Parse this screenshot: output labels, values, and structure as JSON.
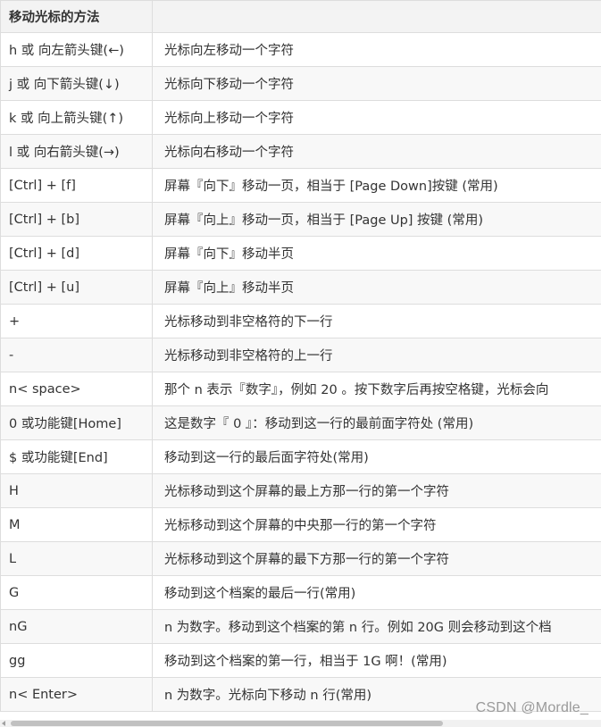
{
  "table": {
    "header": {
      "key": "移动光标的方法",
      "desc": ""
    },
    "rows": [
      {
        "key": "h 或 向左箭头键(←)",
        "desc": "光标向左移动一个字符"
      },
      {
        "key": "j 或 向下箭头键(↓)",
        "desc": "光标向下移动一个字符"
      },
      {
        "key": "k 或 向上箭头键(↑)",
        "desc": "光标向上移动一个字符"
      },
      {
        "key": "l 或 向右箭头键(→)",
        "desc": "光标向右移动一个字符"
      },
      {
        "key": "[Ctrl] + [f]",
        "desc": "屏幕『向下』移动一页，相当于 [Page Down]按键 (常用)"
      },
      {
        "key": "[Ctrl] + [b]",
        "desc": "屏幕『向上』移动一页，相当于 [Page Up] 按键 (常用)"
      },
      {
        "key": "[Ctrl] + [d]",
        "desc": "屏幕『向下』移动半页"
      },
      {
        "key": "[Ctrl] + [u]",
        "desc": "屏幕『向上』移动半页"
      },
      {
        "key": "+",
        "desc": "光标移动到非空格符的下一行"
      },
      {
        "key": "-",
        "desc": "光标移动到非空格符的上一行"
      },
      {
        "key": "n< space>",
        "desc": "那个 n 表示『数字』，例如 20 。按下数字后再按空格键，光标会向"
      },
      {
        "key": "0 或功能键[Home]",
        "desc": "这是数字『 0 』：移动到这一行的最前面字符处 (常用)"
      },
      {
        "key": "$ 或功能键[End]",
        "desc": "移动到这一行的最后面字符处(常用)"
      },
      {
        "key": "H",
        "desc": "光标移动到这个屏幕的最上方那一行的第一个字符"
      },
      {
        "key": "M",
        "desc": "光标移动到这个屏幕的中央那一行的第一个字符"
      },
      {
        "key": "L",
        "desc": "光标移动到这个屏幕的最下方那一行的第一个字符"
      },
      {
        "key": "G",
        "desc": "移动到这个档案的最后一行(常用)"
      },
      {
        "key": "nG",
        "desc": "n 为数字。移动到这个档案的第 n 行。例如 20G 则会移动到这个档"
      },
      {
        "key": "gg",
        "desc": "移动到这个档案的第一行，相当于 1G 啊！(常用)"
      },
      {
        "key": "n< Enter>",
        "desc": "n 为数字。光标向下移动 n 行(常用)"
      }
    ]
  },
  "watermark": "CSDN @Mordle_"
}
